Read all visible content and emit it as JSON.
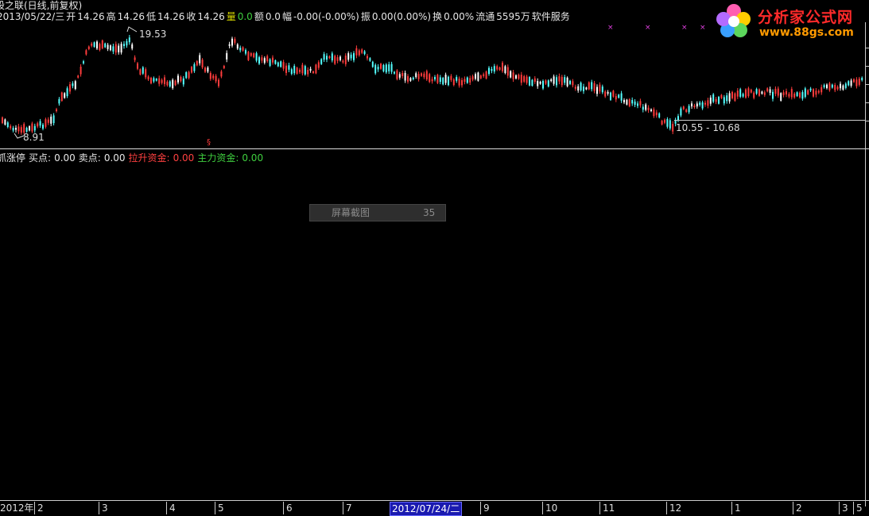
{
  "header": {
    "title": "股之联(日线,前复权)",
    "date": "2013/05/22/三",
    "open_label": "开",
    "open": "14.26",
    "high_label": "高",
    "high": "14.26",
    "low_label": "低",
    "low": "14.26",
    "close_label": "收",
    "close": "14.26",
    "volume_label": "量",
    "volume": "0.0",
    "amount_label": "额",
    "amount": "0.0",
    "change_label": "幅",
    "change": "-0.00(-0.00%)",
    "amplitude_label": "振",
    "amplitude": "0.00(0.00%)",
    "turnover_label": "换",
    "turnover": "0.00%",
    "float_label": "流通",
    "float": "5595万",
    "service": "软件服务"
  },
  "chart": {
    "high_marker": "19.53",
    "low_marker": "8.91",
    "range_label": "10.55 - 10.68",
    "colors": {
      "up": "#ff3c3c",
      "down": "#54ffff",
      "neutral": "#ffffff"
    }
  },
  "indicator": {
    "name": "抓涨停",
    "buy_label": "买点:",
    "buy": "0.00",
    "sell_label": "卖点:",
    "sell": "0.00",
    "lift_label": "拉升资金:",
    "lift": "0.00",
    "main_label": "主力资金:",
    "main": "0.00"
  },
  "popup": {
    "title": "屏幕截图",
    "number": "35"
  },
  "xaxis": {
    "ticks": [
      "2012年",
      "2",
      "3",
      "4",
      "5",
      "6",
      "7",
      "9",
      "10",
      "11",
      "12",
      "1",
      "2",
      "3",
      "5"
    ],
    "highlight": "2012/07/24/二"
  },
  "logo": {
    "name": "分析家公式网",
    "url": "www.88gs.com"
  }
}
